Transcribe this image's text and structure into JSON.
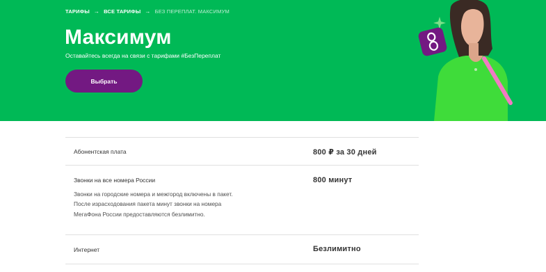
{
  "breadcrumb": {
    "items": [
      "ТАРИФЫ",
      "ВСЕ ТАРИФЫ"
    ],
    "current": "БЕЗ ПЕРЕПЛАТ. МАКСИМУМ",
    "separator": "→"
  },
  "hero": {
    "title": "Максимум",
    "subtitle": "Оставайтесь всегда на связи с тарифами #БезПереплат",
    "button_label": "Выбрать",
    "background_color": "#00b956",
    "button_color": "#731982",
    "badge_icon": "infinity-icon",
    "badge_color": "#731982",
    "accent_color": "#f27ac3"
  },
  "tariff": {
    "fee": {
      "label": "Абонентская плата",
      "value": "800 ₽ за 30 дней"
    },
    "calls": {
      "label": "Звонки на все номера России",
      "value": "800 минут",
      "description": "Звонки на городские номера и межгород включены в пакет. После израсходования пакета минут звонки на номера МегаФона России предоставляются безлимитно."
    },
    "internet": {
      "label": "Интернет",
      "value": "Безлимитно"
    }
  }
}
